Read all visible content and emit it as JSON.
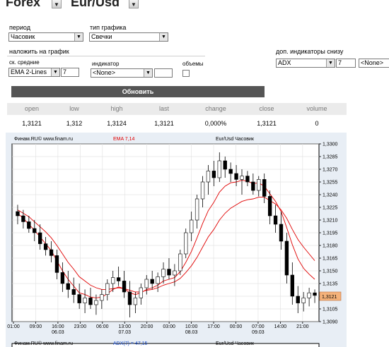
{
  "header": {
    "market": "Forex",
    "pair": "Eur/Usd"
  },
  "controls": {
    "period_label": "период",
    "period_value": "Часовик",
    "chart_type_label": "тип графика",
    "chart_type_value": "Свечки",
    "overlay_label": "наложить на график",
    "ma_label": "ск. средние",
    "ma_value": "EMA 2-Lines",
    "ma_param": "7",
    "indicator_label": "индикатор",
    "indicator_value": "<None>",
    "volume_label": "объемы",
    "bottom_label": "доп. индикаторы снизу",
    "bottom_value": "ADX",
    "bottom_param": "7",
    "bottom_value2": "<None>",
    "update_button": "Обновить"
  },
  "quote": {
    "headers": [
      "open",
      "low",
      "high",
      "last",
      "change",
      "close",
      "volume"
    ],
    "values": [
      "1,3121",
      "1,312",
      "1,3124",
      "1,3121",
      "0,000%",
      "1,3121",
      "0"
    ]
  },
  "chart_data": {
    "type": "candlestick",
    "source": "Финам.RU© www.finam.ru",
    "overlay_label": "EMA 7,14",
    "title": "Eur/Usd Часовик",
    "ylim": [
      1.309,
      1.33
    ],
    "y_ticks": [
      "1,3300",
      "1,3285",
      "1,3270",
      "1,3255",
      "1,3240",
      "1,3225",
      "1,3210",
      "1,3195",
      "1,3180",
      "1,3165",
      "1,3150",
      "1,3135",
      "1,3120",
      "1,3105",
      "1,3090"
    ],
    "last_price": "1,3121",
    "x_ticks": [
      "01:00",
      "09:00",
      "16:00",
      "23:00",
      "06:00",
      "13:00",
      "20:00",
      "03:00",
      "10:00",
      "17:00",
      "00:00",
      "07:00",
      "14:00",
      "21:00"
    ],
    "date_labels": [
      "06.03",
      "07.03",
      "08.03",
      "09.03"
    ],
    "ohlc": [
      [
        1.322,
        1.3228,
        1.3205,
        1.3215
      ],
      [
        1.3215,
        1.3222,
        1.32,
        1.3208
      ],
      [
        1.3208,
        1.3215,
        1.3195,
        1.32
      ],
      [
        1.32,
        1.321,
        1.3185,
        1.3195
      ],
      [
        1.3195,
        1.3205,
        1.3175,
        1.3182
      ],
      [
        1.3182,
        1.319,
        1.3168,
        1.3175
      ],
      [
        1.3175,
        1.3185,
        1.316,
        1.3168
      ],
      [
        1.3168,
        1.3175,
        1.314,
        1.3148
      ],
      [
        1.3148,
        1.316,
        1.3125,
        1.3135
      ],
      [
        1.3135,
        1.315,
        1.3118,
        1.3128
      ],
      [
        1.3128,
        1.3142,
        1.3112,
        1.3122
      ],
      [
        1.3122,
        1.3135,
        1.3105,
        1.3112
      ],
      [
        1.3112,
        1.3128,
        1.31,
        1.3118
      ],
      [
        1.3118,
        1.313,
        1.3105,
        1.311
      ],
      [
        1.311,
        1.3122,
        1.3098,
        1.3115
      ],
      [
        1.3115,
        1.3128,
        1.3105,
        1.3122
      ],
      [
        1.3122,
        1.314,
        1.3115,
        1.3135
      ],
      [
        1.3135,
        1.315,
        1.3125,
        1.3142
      ],
      [
        1.3142,
        1.3155,
        1.3132,
        1.3138
      ],
      [
        1.3138,
        1.315,
        1.3118,
        1.3125
      ],
      [
        1.3125,
        1.3138,
        1.3095,
        1.311
      ],
      [
        1.311,
        1.3125,
        1.31,
        1.3118
      ],
      [
        1.3118,
        1.3135,
        1.311,
        1.313
      ],
      [
        1.313,
        1.3145,
        1.3122,
        1.314
      ],
      [
        1.314,
        1.315,
        1.3128,
        1.3135
      ],
      [
        1.3135,
        1.3148,
        1.3125,
        1.3143
      ],
      [
        1.3143,
        1.316,
        1.3135,
        1.3152
      ],
      [
        1.3152,
        1.3165,
        1.314,
        1.3145
      ],
      [
        1.3145,
        1.3158,
        1.3132,
        1.315
      ],
      [
        1.315,
        1.3175,
        1.3145,
        1.317
      ],
      [
        1.317,
        1.32,
        1.3165,
        1.3195
      ],
      [
        1.3195,
        1.322,
        1.3185,
        1.321
      ],
      [
        1.321,
        1.324,
        1.32,
        1.3235
      ],
      [
        1.3235,
        1.3262,
        1.3225,
        1.3255
      ],
      [
        1.3255,
        1.3275,
        1.324,
        1.3268
      ],
      [
        1.3268,
        1.328,
        1.325,
        1.326
      ],
      [
        1.326,
        1.329,
        1.3255,
        1.328
      ],
      [
        1.328,
        1.3285,
        1.326,
        1.327
      ],
      [
        1.327,
        1.3278,
        1.3255,
        1.3265
      ],
      [
        1.3265,
        1.3275,
        1.325,
        1.3258
      ],
      [
        1.3258,
        1.327,
        1.324,
        1.3262
      ],
      [
        1.3262,
        1.3268,
        1.325,
        1.3255
      ],
      [
        1.3255,
        1.3265,
        1.324,
        1.3245
      ],
      [
        1.3245,
        1.3262,
        1.3238,
        1.3258
      ],
      [
        1.3258,
        1.3265,
        1.323,
        1.3238
      ],
      [
        1.3238,
        1.3245,
        1.3205,
        1.3215
      ],
      [
        1.3215,
        1.3228,
        1.3195,
        1.3205
      ],
      [
        1.3205,
        1.322,
        1.3175,
        1.3185
      ],
      [
        1.3185,
        1.3195,
        1.3135,
        1.3145
      ],
      [
        1.3145,
        1.316,
        1.311,
        1.312
      ],
      [
        1.312,
        1.3132,
        1.31,
        1.3112
      ],
      [
        1.3112,
        1.3125,
        1.3102,
        1.3118
      ],
      [
        1.3118,
        1.313,
        1.3108,
        1.3124
      ],
      [
        1.3124,
        1.3128,
        1.3112,
        1.3121
      ]
    ],
    "ema_fast": [
      1.3218,
      1.3212,
      1.3205,
      1.3198,
      1.319,
      1.3182,
      1.3174,
      1.3162,
      1.315,
      1.314,
      1.3132,
      1.3124,
      1.3122,
      1.3119,
      1.3118,
      1.3119,
      1.3123,
      1.3128,
      1.3131,
      1.3129,
      1.3124,
      1.3122,
      1.3124,
      1.3128,
      1.313,
      1.3133,
      1.3138,
      1.314,
      1.3142,
      1.3149,
      1.316,
      1.3173,
      1.3189,
      1.3206,
      1.3221,
      1.3231,
      1.3243,
      1.325,
      1.3254,
      1.3255,
      1.3257,
      1.3256,
      1.3253,
      1.3254,
      1.325,
      1.3241,
      1.3232,
      1.322,
      1.3201,
      1.3181,
      1.3164,
      1.3153,
      1.3146,
      1.314
    ],
    "ema_slow": [
      1.3222,
      1.3218,
      1.3214,
      1.3208,
      1.3202,
      1.3196,
      1.3189,
      1.318,
      1.317,
      1.316,
      1.3152,
      1.3143,
      1.3138,
      1.3133,
      1.313,
      1.3128,
      1.3128,
      1.3129,
      1.313,
      1.3129,
      1.3127,
      1.3125,
      1.3125,
      1.3127,
      1.3128,
      1.313,
      1.3133,
      1.3135,
      1.3137,
      1.3141,
      1.3148,
      1.3156,
      1.3166,
      1.3178,
      1.319,
      1.3199,
      1.321,
      1.3218,
      1.3224,
      1.3228,
      1.3232,
      1.3234,
      1.3235,
      1.3237,
      1.3237,
      1.3233,
      1.3229,
      1.3222,
      1.3212,
      1.3199,
      1.3187,
      1.3178,
      1.317,
      1.3162
    ],
    "lower_panel": {
      "source": "Финам.RU© www.finam.ru",
      "label": "ADX(7) = 47,15",
      "title": "Eur/Usd Часовик"
    }
  },
  "colors": {
    "candle_up": "#ffffff",
    "candle_down": "#000000",
    "ema_line": "#e00000",
    "last_box": "#f5b27a",
    "panel_bg": "#ffffff",
    "frame": "#e8eef5"
  }
}
